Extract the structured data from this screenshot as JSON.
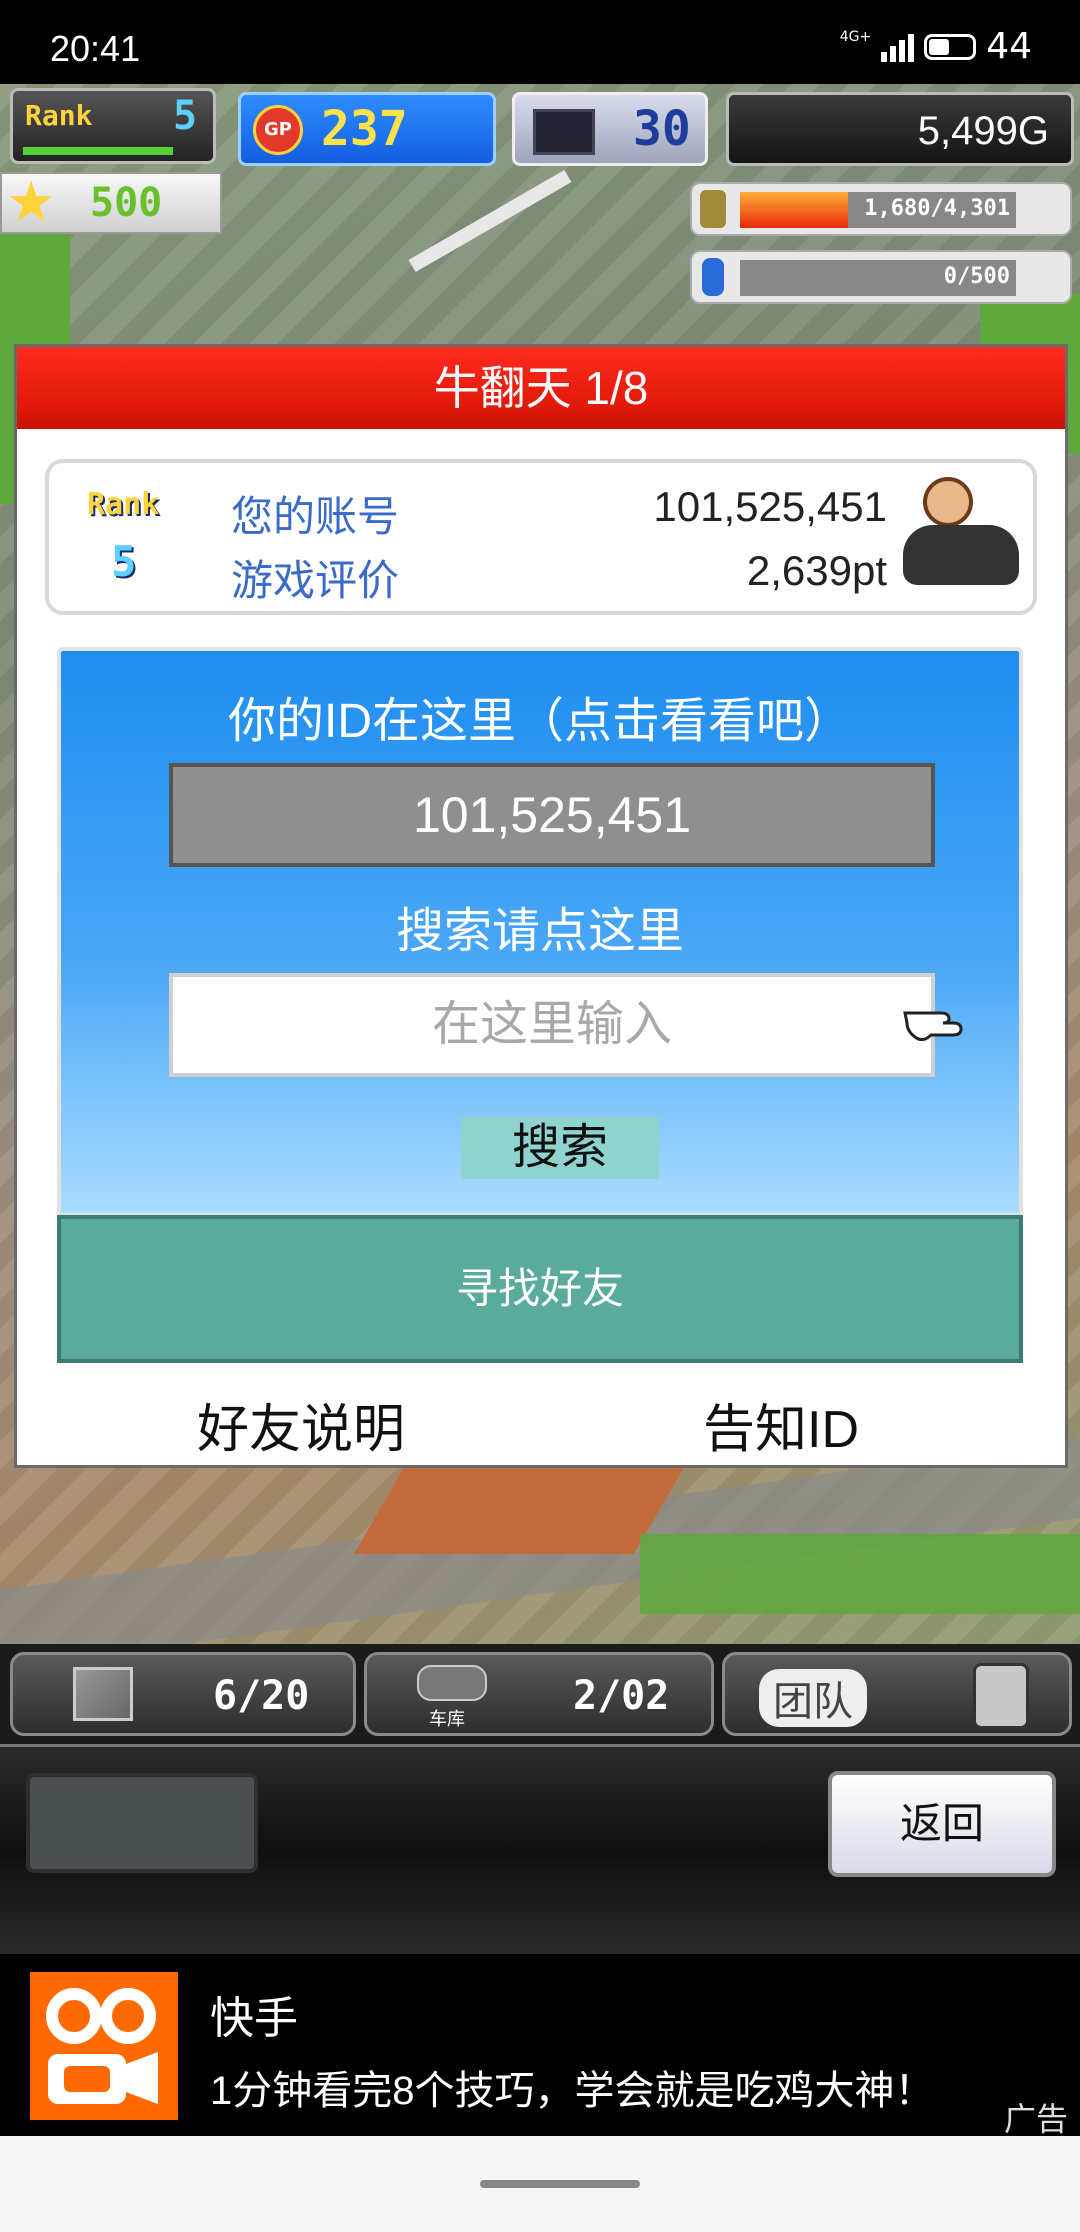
{
  "status_bar": {
    "time": "20:41",
    "network": "4G+",
    "battery": "44"
  },
  "hud": {
    "rank_label": "Rank",
    "rank_value": "5",
    "gp_label": "GP",
    "gp_value": "237",
    "research_value": "30",
    "money": "5,499G",
    "star_value": "500",
    "resource1": "1,680/4,301",
    "resource2": "0/500"
  },
  "dialog": {
    "title": "牛翻天 1/8",
    "card": {
      "rank_label": "Rank",
      "rank_value": "5",
      "account_label": "您的账号",
      "account_value": "101,525,451",
      "rating_label": "游戏评价",
      "rating_value": "2,639pt"
    },
    "id_prompt": "你的ID在这里（点击看看吧）",
    "id_value": "101,525,451",
    "search_prompt": "搜索请点这里",
    "search_placeholder": "在这里输入",
    "search_button": "搜索",
    "find_friends": "寻找好友",
    "friend_help": "好友说明",
    "tell_id": "告知ID"
  },
  "bottom_tabs": {
    "tab1": "6/20",
    "garage_label": "车库",
    "tab2": "2/02",
    "team_label": "团队"
  },
  "controls": {
    "back_button": "返回"
  },
  "ad": {
    "title": "快手",
    "text": "1分钟看完8个技巧，学会就是吃鸡大神！",
    "tag": "广告"
  },
  "colors": {
    "title_red": "#e21a0a",
    "panel_blue": "#1e8df0",
    "teal_button": "#5aab99",
    "ad_orange": "#ff6a00"
  }
}
